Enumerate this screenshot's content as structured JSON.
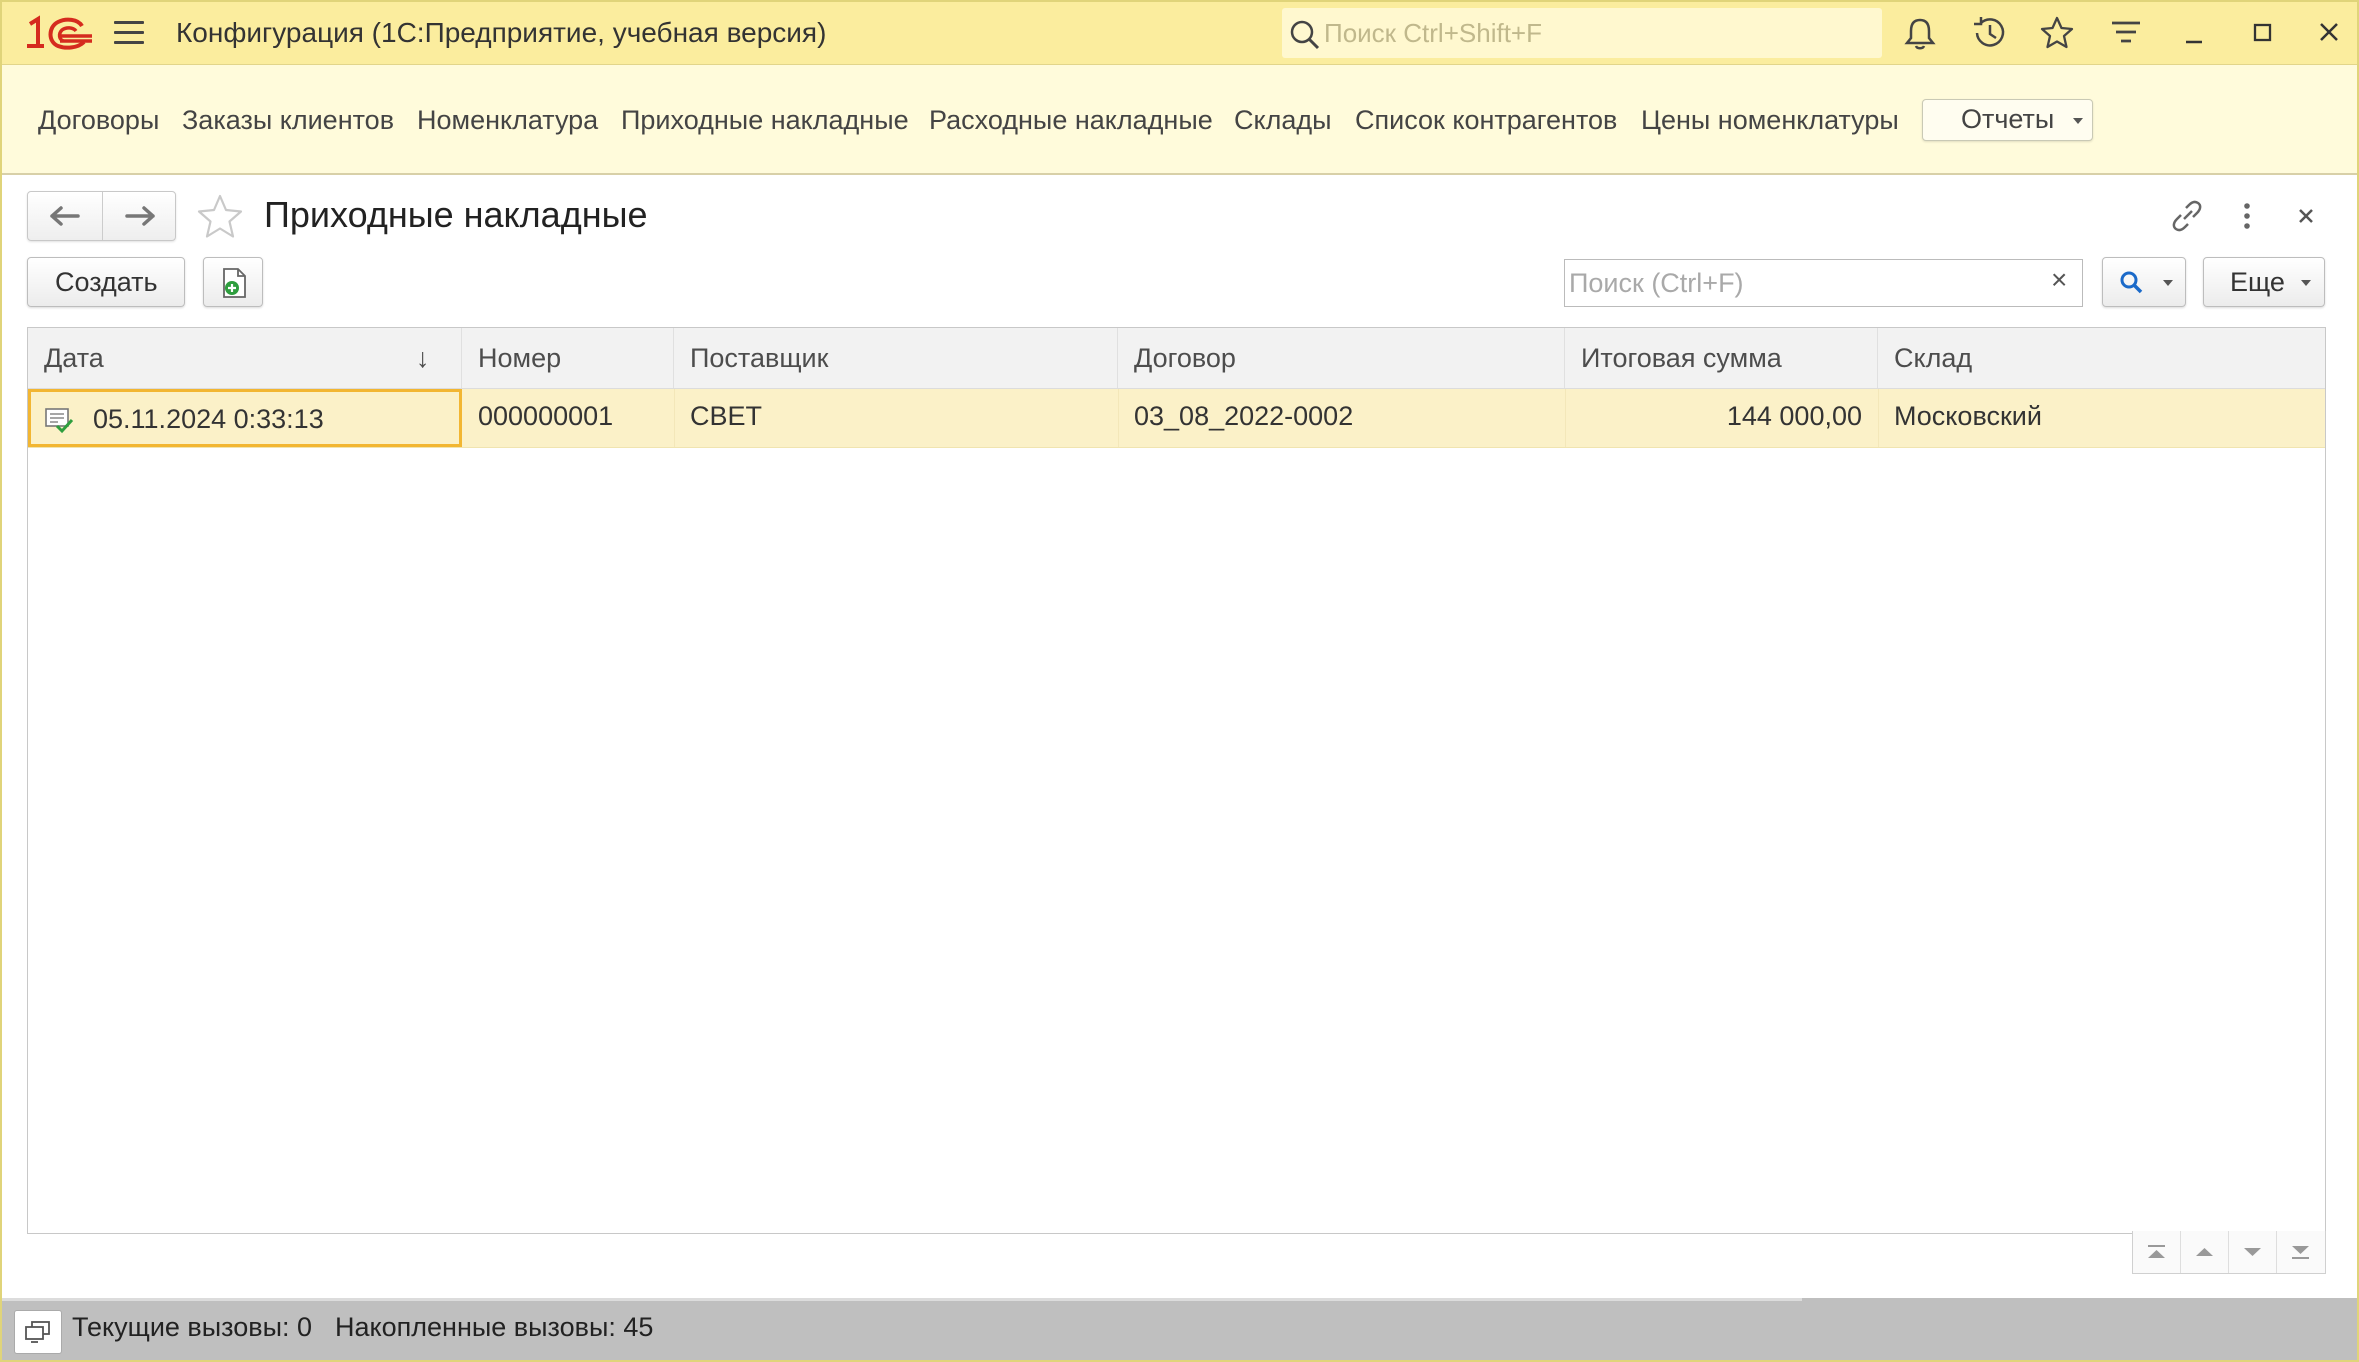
{
  "app": {
    "title": "Конфигурация  (1С:Предприятие, учебная версия)",
    "global_search_placeholder": "Поиск Ctrl+Shift+F"
  },
  "sections": [
    {
      "label": "Договоры"
    },
    {
      "label": "Заказы клиентов"
    },
    {
      "label": "Номенклатура"
    },
    {
      "label": "Приходные накладные"
    },
    {
      "label": "Расходные накладные"
    },
    {
      "label": "Склады"
    },
    {
      "label": "Список контрагентов"
    },
    {
      "label": "Цены номенклатуры"
    }
  ],
  "reports_label": "Отчеты",
  "form": {
    "title": "Приходные накладные",
    "create_label": "Создать",
    "search_placeholder": "Поиск (Ctrl+F)",
    "clear_symbol": "×",
    "more_label": "Еще"
  },
  "table": {
    "columns": [
      "Дата",
      "Номер",
      "Поставщик",
      "Договор",
      "Итоговая сумма",
      "Склад"
    ],
    "sort_indicator": "↓",
    "rows": [
      {
        "date": "05.11.2024 0:33:13",
        "number": "000000001",
        "supplier": "СВЕТ",
        "contract": "03_08_2022-0002",
        "total": "144 000,00",
        "warehouse": "Московский"
      }
    ]
  },
  "status": {
    "current_calls": "Текущие вызовы: 0",
    "accumulated_calls": "Накопленные вызовы: 45"
  },
  "colors": {
    "titlebar": "#fbed9e",
    "sections_bar": "#fffbdb",
    "selected_row": "#fbf1c8",
    "active_cell_border": "#f2b632",
    "logo_red": "#d52b1e",
    "status_bar": "#bfbfbf"
  }
}
